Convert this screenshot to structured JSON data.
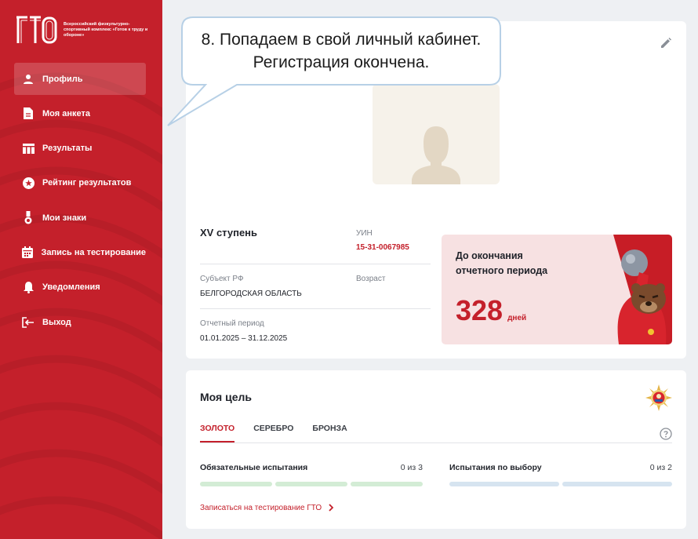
{
  "logo": {
    "mark": "ГТО",
    "tagline": "Всероссийский физкультурно-спортивный комплекс «Готов к труду и обороне»"
  },
  "sidebar": {
    "items": [
      {
        "label": "Профиль",
        "icon": "person-icon",
        "active": true
      },
      {
        "label": "Моя анкета",
        "icon": "document-icon"
      },
      {
        "label": "Результаты",
        "icon": "table-icon"
      },
      {
        "label": "Рейтинг результатов",
        "icon": "star-icon"
      },
      {
        "label": "Мои знаки",
        "icon": "medal-icon"
      },
      {
        "label": "Запись на тестирование",
        "icon": "calendar-icon"
      },
      {
        "label": "Уведомления",
        "icon": "bell-icon"
      },
      {
        "label": "Выход",
        "icon": "logout-icon"
      }
    ]
  },
  "profile": {
    "level": "XV ступень",
    "uin_label": "УИН",
    "uin_value": "15-31-0067985",
    "subject_label": "Субъект РФ",
    "subject_value": "БЕЛГОРОДСКАЯ ОБЛАСТЬ",
    "age_label": "Возраст",
    "period_label": "Отчетный период",
    "period_value": "01.01.2025 – 31.12.2025"
  },
  "promo": {
    "title": "До окончания отчетного периода",
    "days": "328",
    "unit": "дней"
  },
  "goal": {
    "title": "Моя цель",
    "tabs": [
      {
        "label": "ЗОЛОТО",
        "active": true
      },
      {
        "label": "СЕРЕБРО"
      },
      {
        "label": "БРОНЗА"
      }
    ],
    "mandatory": {
      "title": "Обязательные испытания",
      "count": "0 из 3",
      "bars": 3
    },
    "optional": {
      "title": "Испытания по выбору",
      "count": "0 из 2",
      "bars": 2
    },
    "link": "Записаться на тестирование ГТО"
  },
  "callout": {
    "text": "8. Попадаем в свой личный кабинет. Регистрация окончена."
  },
  "colors": {
    "brand_red": "#c4202b",
    "bar_green": "#d3ecd5",
    "bar_blue": "#d6e4f0"
  }
}
